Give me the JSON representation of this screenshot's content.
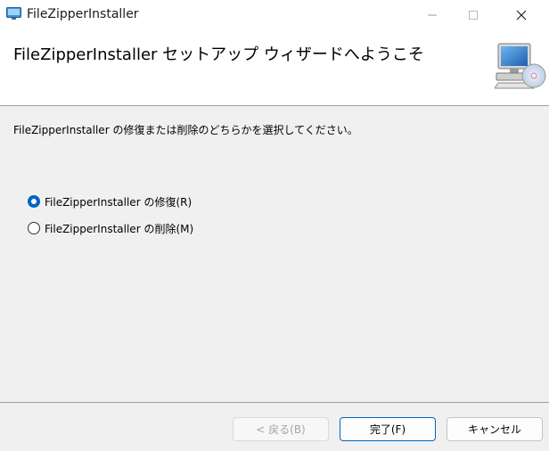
{
  "window": {
    "title": "FileZipperInstaller",
    "icon": "installer-app-icon"
  },
  "header": {
    "title": "FileZipperInstaller セットアップ ウィザードへようこそ",
    "icon": "computer-cd-icon"
  },
  "body": {
    "instruction": "FileZipperInstaller の修復または削除のどちらかを選択してください。",
    "options": [
      {
        "label": "FileZipperInstaller の修復(R)",
        "selected": true
      },
      {
        "label": "FileZipperInstaller の削除(M)",
        "selected": false
      }
    ]
  },
  "buttons": {
    "back": "< 戻る(B)",
    "finish": "完了(F)",
    "cancel": "キャンセル"
  },
  "colors": {
    "accent": "#0067c0",
    "disabled_text": "#a5a5a5"
  }
}
